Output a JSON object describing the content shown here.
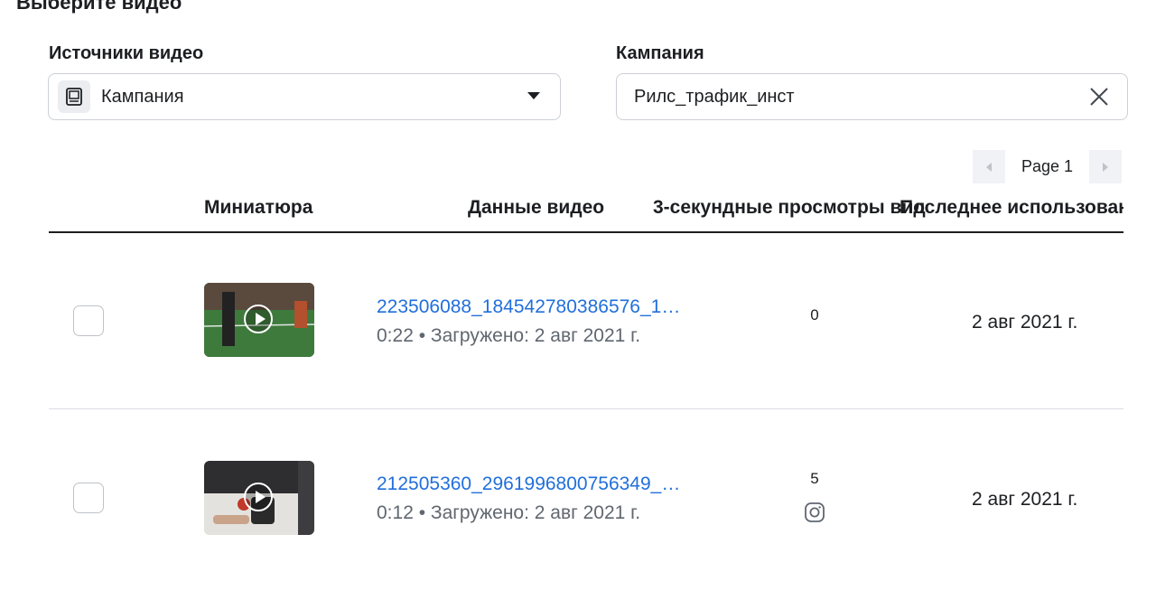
{
  "heading": "Выберите видео",
  "sources": {
    "label": "Источники видео",
    "selected": "Кампания",
    "icon": "monitor-icon"
  },
  "campaign": {
    "label": "Кампания",
    "value": "Рилс_трафик_инст",
    "clear_icon": "close-icon"
  },
  "pager": {
    "label": "Page 1"
  },
  "table": {
    "columns": {
      "thumbnail": "Миниатюра",
      "video_data": "Данные видео",
      "views": "3-секундные просмотры вид",
      "last_used": "Последнее использовани"
    },
    "rows": [
      {
        "name": "223506088_184542780386576_1…",
        "meta": "0:22 • Загружено: 2 авг 2021 г.",
        "views": "0",
        "last_used": "2 авг 2021 г.",
        "platform_icon": ""
      },
      {
        "name": "212505360_2961996800756349_…",
        "meta": "0:12 • Загружено: 2 авг 2021 г.",
        "views": "5",
        "last_used": "2 авг 2021 г.",
        "platform_icon": "instagram-icon"
      }
    ]
  },
  "colors": {
    "link": "#216fdb",
    "muted": "#606770",
    "border": "#ccd0d5"
  }
}
